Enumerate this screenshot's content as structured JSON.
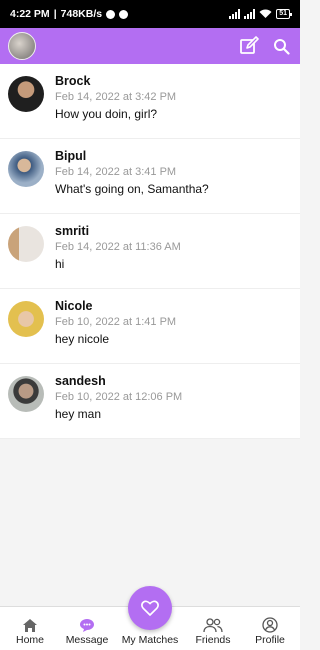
{
  "status_bar": {
    "time": "4:22 PM",
    "speed": "748KB/s",
    "battery": "51"
  },
  "header": {
    "compose_icon": "compose-icon",
    "search_icon": "search-icon"
  },
  "conversations": [
    {
      "name": "Brock",
      "date": "Feb 14, 2022 at 3:42 PM",
      "message": "How you doin, girl?",
      "avatar_color": "#1f1f1f"
    },
    {
      "name": "Bipul",
      "date": "Feb 14, 2022 at 3:41 PM",
      "message": "What's going on, Samantha?",
      "avatar_color": "#5b7ea6"
    },
    {
      "name": "smriti",
      "date": "Feb 14, 2022 at 11:36 AM",
      "message": "hi",
      "avatar_color": "#c9a37a"
    },
    {
      "name": "Nicole",
      "date": "Feb 10, 2022 at 1:41 PM",
      "message": "hey nicole",
      "avatar_color": "#e3c04f"
    },
    {
      "name": "sandesh",
      "date": "Feb 10, 2022 at 12:06 PM",
      "message": "hey man",
      "avatar_color": "#8a8f8a"
    }
  ],
  "bottom_nav": {
    "home": "Home",
    "message": "Message",
    "my_matches": "My Matches",
    "friends": "Friends",
    "profile": "Profile"
  },
  "colors": {
    "accent": "#b36ef2",
    "date_text": "#999999"
  }
}
